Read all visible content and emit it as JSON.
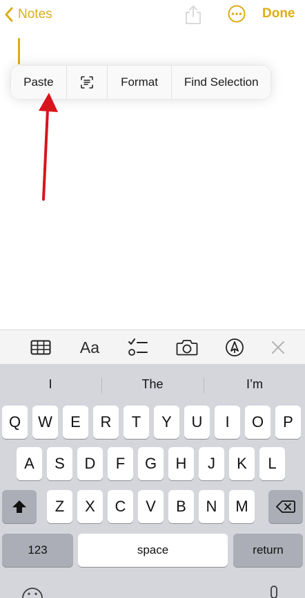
{
  "nav": {
    "back_label": "Notes",
    "done_label": "Done",
    "accent_color": "#dcae16"
  },
  "edit_menu": {
    "paste": "Paste",
    "format": "Format",
    "find_selection": "Find Selection"
  },
  "toolbar": {
    "font_label": "Aa"
  },
  "predictions": [
    "I",
    "The",
    "I’m"
  ],
  "keyboard": {
    "row1": [
      "Q",
      "W",
      "E",
      "R",
      "T",
      "Y",
      "U",
      "I",
      "O",
      "P"
    ],
    "row2": [
      "A",
      "S",
      "D",
      "F",
      "G",
      "H",
      "J",
      "K",
      "L"
    ],
    "row3": [
      "Z",
      "X",
      "C",
      "V",
      "B",
      "N",
      "M"
    ],
    "numbers_label": "123",
    "space_label": "space",
    "return_label": "return"
  },
  "icons": [
    "chevron-left-icon",
    "share-icon",
    "more-icon",
    "text-scan-icon",
    "table-icon",
    "checklist-icon",
    "camera-icon",
    "markup-icon",
    "close-icon",
    "shift-icon",
    "delete-icon",
    "emoji-icon",
    "dictation-icon"
  ]
}
